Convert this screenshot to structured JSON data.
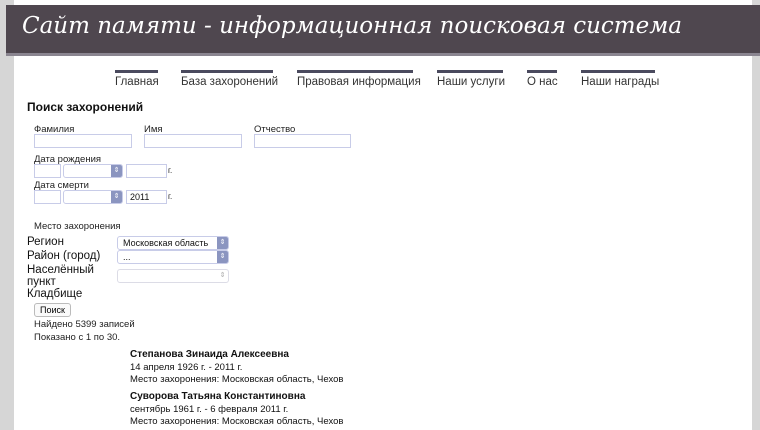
{
  "header": {
    "title": "Сайт памяти - информационная поисковая система"
  },
  "nav": [
    "Главная",
    "База захоронений",
    "Правовая информация",
    "Наши услуги",
    "О нас",
    "Наши награды"
  ],
  "form": {
    "title": "Поиск захоронений",
    "surname_label": "Фамилия",
    "name_label": "Имя",
    "patronymic_label": "Отчество",
    "surname": "",
    "name": "",
    "patronymic": "",
    "birth_label": "Дата рождения",
    "birth_day": "",
    "birth_month": "",
    "birth_year": "",
    "death_label": "Дата смерти",
    "death_day": "",
    "death_month": "",
    "death_year": "2011",
    "year_suffix": "г.",
    "place_label": "Место захоронения",
    "region_label": "Регион",
    "region_value": "Московская область",
    "district_label": "Район (город)",
    "district_value": "...",
    "locality_label_1": "Населённый",
    "locality_label_2": "пункт",
    "locality_value": "",
    "cemetery_label": "Кладбище",
    "search_button": "Поиск"
  },
  "results": {
    "found": "Найдено 5399 записей",
    "shown": "Показано с 1 по 30.",
    "items": [
      {
        "name": "Степанова Зинаида Алексеевна",
        "dates": "14 апреля 1926 г. - 2011 г.",
        "place": "Место захоронения: Московская область, Чехов"
      },
      {
        "name": "Суворова Татьяна Константиновна",
        "dates": "сентябрь 1961 г. - 6 февраля 2011 г.",
        "place": "Место захоронения: Московская область, Чехов"
      }
    ]
  }
}
